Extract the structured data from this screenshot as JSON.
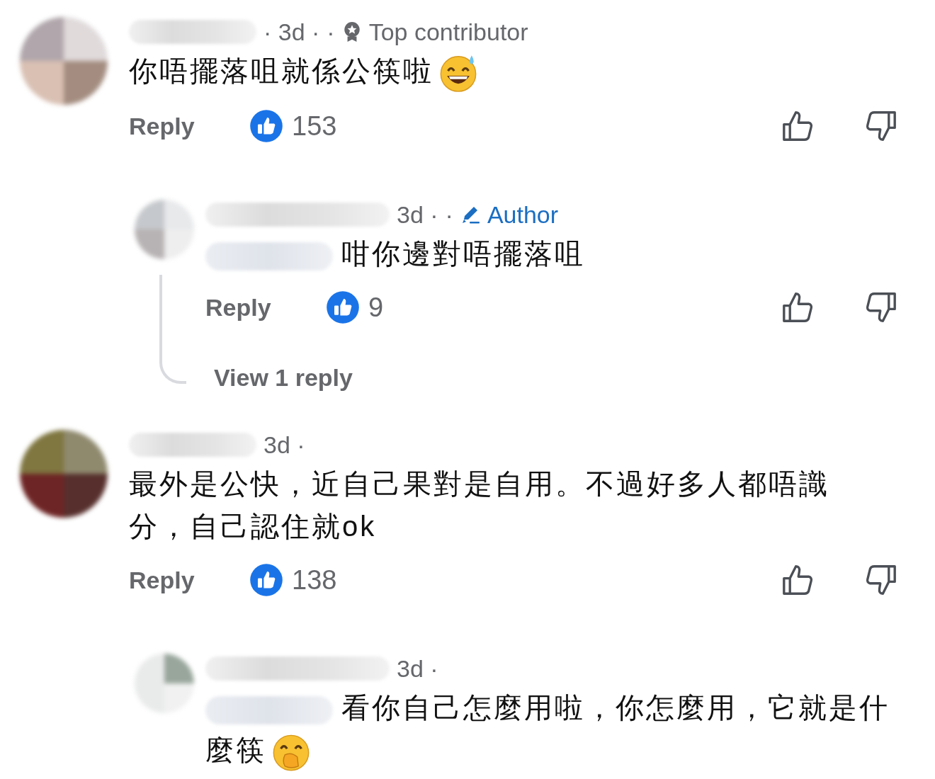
{
  "comments": [
    {
      "kind": "top",
      "time": "· 3d ·",
      "separator": "·",
      "badge": {
        "kind": "top-contributor",
        "label": "Top contributor"
      },
      "text": "你唔擺落咀就係公筷啦",
      "emoji": {
        "kind": "sweat-smile"
      },
      "reply_label": "Reply",
      "likes": "153"
    },
    {
      "kind": "reply",
      "time": "3d ·",
      "separator": "·",
      "badge": {
        "kind": "author",
        "label": "Author"
      },
      "mention": true,
      "text": "咁你邊對唔擺落咀",
      "reply_label": "Reply",
      "likes": "9",
      "view_replies": "View 1 reply"
    },
    {
      "kind": "top",
      "time": "3d ·",
      "text": "最外是公快，近自己果對是自用。不過好多人都唔識分，自己認住就ok",
      "reply_label": "Reply",
      "likes": "138"
    },
    {
      "kind": "reply",
      "time": "3d ·",
      "mention": true,
      "text": "看你自己怎麼用啦，你怎麼用，它就是什麼筷",
      "emoji": {
        "kind": "hand-over-mouth"
      }
    }
  ]
}
